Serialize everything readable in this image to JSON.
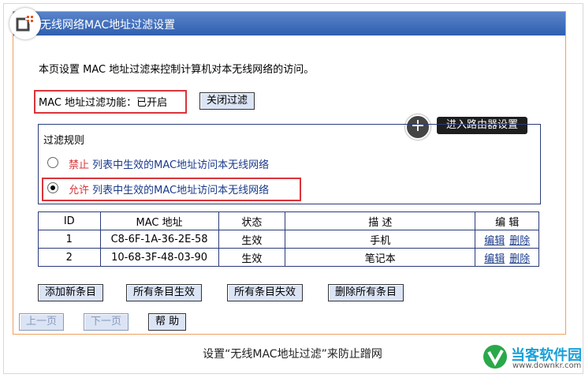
{
  "window": {
    "title": "无线网络MAC地址过滤设置"
  },
  "intro": "本页设置 MAC 地址过滤来控制计算机对本无线网络的访问。",
  "filter_status": {
    "label": "MAC 地址过滤功能：已开启",
    "button": "关闭过滤"
  },
  "tooltip": {
    "plus": "+",
    "label": "进入路由器设置"
  },
  "rules": {
    "title": "过滤规则",
    "options": [
      {
        "keyword": "禁止",
        "text": "列表中生效的MAC地址访问本无线网络",
        "selected": false
      },
      {
        "keyword": "允许",
        "text": "列表中生效的MAC地址访问本无线网络",
        "selected": true
      }
    ]
  },
  "table": {
    "headers": [
      "ID",
      "MAC 地址",
      "状态",
      "描 述",
      "编 辑"
    ],
    "rows": [
      {
        "id": "1",
        "mac": "C8-6F-1A-36-2E-58",
        "status": "生效",
        "desc": "手机",
        "edit": "编辑",
        "delete": "删除"
      },
      {
        "id": "2",
        "mac": "10-68-3F-48-03-90",
        "status": "生效",
        "desc": "笔记本",
        "edit": "编辑",
        "delete": "删除"
      }
    ]
  },
  "actions": {
    "add": "添加新条目",
    "enable_all": "所有条目生效",
    "disable_all": "所有条目失效",
    "delete_all": "删除所有条目"
  },
  "pager": {
    "prev": "上一页",
    "next": "下一页",
    "help": "帮 助"
  },
  "caption": "设置“无线MAC地址过滤”来防止蹭网",
  "brand": {
    "name": "当客软件园",
    "url": "www.downkr.com"
  },
  "colors": {
    "accent_red": "#d9343a",
    "title_bar": "#3b6cbf",
    "border": "#2a3c7a"
  }
}
